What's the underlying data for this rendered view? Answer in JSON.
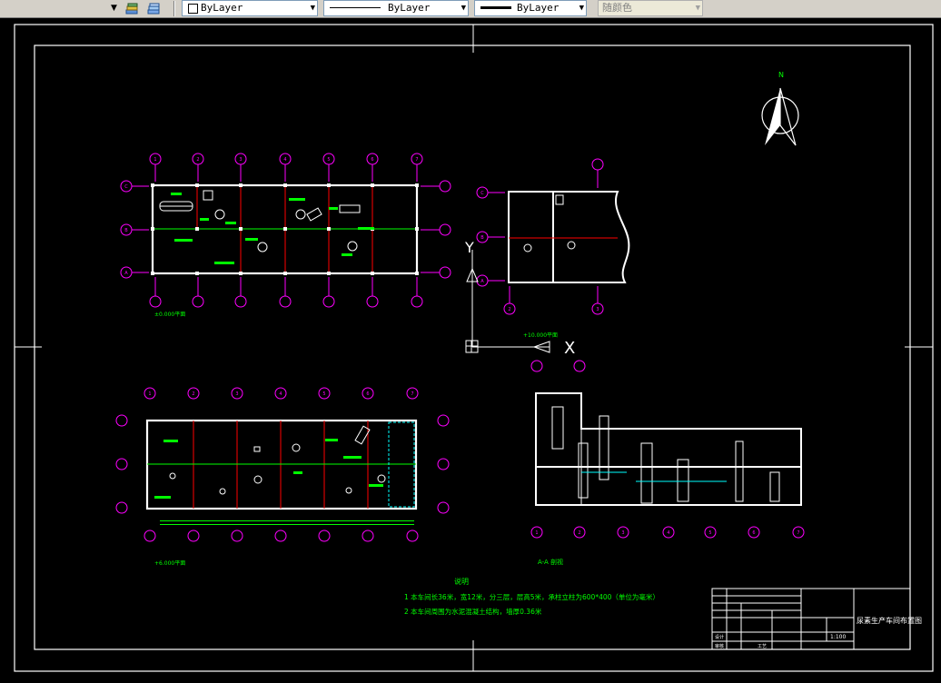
{
  "toolbar": {
    "layer_dropdown_arrow": "▼",
    "color_control": "ByLayer",
    "linetype_control": "ByLayer",
    "lineweight_control": "ByLayer",
    "plotstyle_control": "随颜色",
    "icons": [
      "layer-states-icon",
      "layer-previous-icon"
    ]
  },
  "drawing": {
    "north_label": "N",
    "plan_top_label": "±0.000平面",
    "plan_bottom_label": "+6.000平面",
    "section_small_label": "+10.000平面",
    "section_label": "A-A 剖视",
    "grid_letters_plan": [
      "C",
      "B",
      "A"
    ],
    "grid_numbers_plan": [
      "1",
      "2",
      "3",
      "4",
      "5",
      "6",
      "7"
    ],
    "grid_letters_section": [
      "C",
      "B",
      "A"
    ],
    "grid_numbers_section": [
      "2",
      "3"
    ],
    "grid_numbers_aa": [
      "1",
      "2",
      "3",
      "4",
      "5",
      "6",
      "7"
    ],
    "ucs_x": "X",
    "ucs_y": "Y",
    "notes_title": "说明",
    "notes": [
      "1 本车间长36米，宽12米，分三层，层高5米，承柱立柱为600*400（单位为毫米）",
      "2 本车间周围为水泥混凝土结构，墙厚0.36米"
    ],
    "title_block": {
      "drawing_title": "尿素生产车间布置图",
      "scale": "1:100",
      "rows": [
        "设计",
        "审核",
        "工艺"
      ]
    }
  },
  "colors": {
    "background": "#000000",
    "structure": "#ffffff",
    "grid_axis": "#ff00ff",
    "dimension": "#00ff00",
    "red_line": "#ff0000",
    "cyan": "#00ffff",
    "yellow": "#ffff00"
  }
}
